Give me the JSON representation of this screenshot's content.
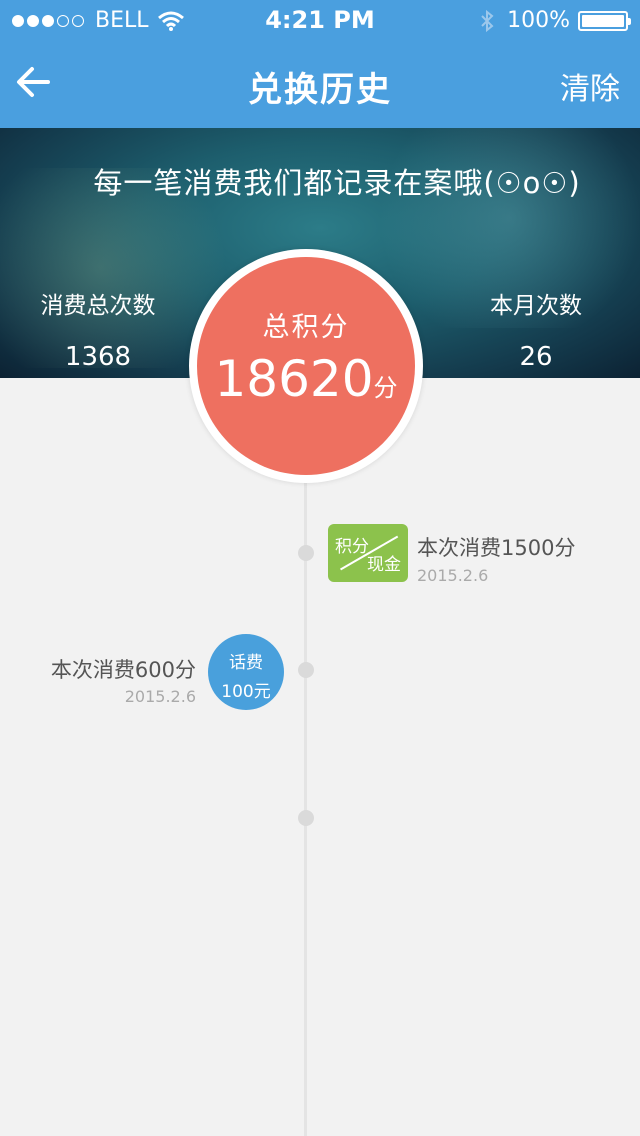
{
  "status_bar": {
    "carrier": "BELL",
    "time": "4:21 PM",
    "battery": "100%"
  },
  "nav": {
    "title": "兑换历史",
    "clear_label": "清除"
  },
  "hero": {
    "tagline": "每一笔消费我们都记录在案哦(☉o☉)",
    "total_count_label": "消费总次数",
    "total_count_value": "1368",
    "month_count_label": "本月次数",
    "month_count_value": "26"
  },
  "points": {
    "label": "总积分",
    "value": "18620",
    "unit": "分"
  },
  "timeline": [
    {
      "badge_top": "积分",
      "badge_bottom": "现金",
      "title": "本次消费1500分",
      "date": "2015.2.6"
    },
    {
      "badge_top": "话费",
      "badge_bottom": "100元",
      "title": "本次消费600分",
      "date": "2015.2.6"
    }
  ],
  "colors": {
    "primary": "#4a9fdf",
    "points_circle": "#ee7060",
    "green_badge": "#8cc24c",
    "blue_badge": "#49a0dc"
  }
}
